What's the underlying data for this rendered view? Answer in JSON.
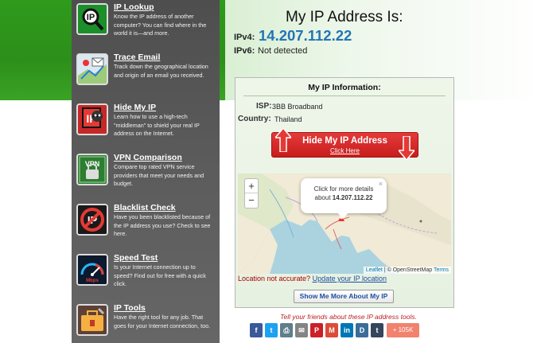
{
  "sidebar": {
    "items": [
      {
        "title": "IP Lookup",
        "desc": "Know the IP address of another computer? You can find where in the world it is—and more.",
        "icon": "ip-lookup-icon"
      },
      {
        "title": "Trace Email",
        "desc": "Track down the geographical location and origin of an email you received.",
        "icon": "trace-email-icon"
      },
      {
        "title": "Hide My IP",
        "desc": "Learn how to use a high-tech \"middleman\" to shield your real IP address on the Internet.",
        "icon": "hide-ip-icon"
      },
      {
        "title": "VPN Comparison",
        "desc": "Compare top rated VPN service providers that meet your needs and budget.",
        "icon": "vpn-icon"
      },
      {
        "title": "Blacklist Check",
        "desc": "Have you been blacklisted because of the IP address you use? Check to see here.",
        "icon": "blacklist-icon"
      },
      {
        "title": "Speed Test",
        "desc": "Is your Internet connection up to speed? Find out for free with a quick click.",
        "icon": "speed-test-icon"
      },
      {
        "title": "IP Tools",
        "desc": "Have the right tool for any job. That goes for your Internet connection, too.",
        "icon": "ip-tools-icon"
      }
    ],
    "icon_texts": {
      "vpn": "VPN",
      "speed": "Mbps",
      "ip": "IP"
    }
  },
  "header": {
    "title": "My IP Address Is:",
    "ipv4_label": "IPv4:",
    "ipv4_value": "14.207.112.22",
    "ipv6_label": "IPv6:",
    "ipv6_value": "Not detected"
  },
  "info": {
    "title": "My IP Information:",
    "isp_label": "ISP:",
    "isp_value": "3BB Broadband",
    "country_label": "Country:",
    "country_value": "Thailand",
    "hide_button_title": "Hide My IP Address",
    "hide_button_sub": "Click Here"
  },
  "map": {
    "zoom_in": "+",
    "zoom_out": "−",
    "popup_line1": "Click for more details",
    "popup_prefix": "about ",
    "popup_ip": "14.207.112.22",
    "popup_close": "×",
    "attr_leaflet": "Leaflet",
    "attr_sep": " | © OpenStreetMap ",
    "attr_terms": "Terms"
  },
  "accuracy": {
    "text": "Location not accurate? ",
    "link": "Update your IP location"
  },
  "more_button": "Show Me More About My IP",
  "share": {
    "text": "Tell your friends about these IP address tools.",
    "buttons": [
      {
        "glyph": "f",
        "color": "#3b5998",
        "icon": "facebook-icon"
      },
      {
        "glyph": "t",
        "color": "#1da1f2",
        "icon": "twitter-icon"
      },
      {
        "glyph": "⎙",
        "color": "#607d8b",
        "icon": "print-icon"
      },
      {
        "glyph": "✉",
        "color": "#848484",
        "icon": "email-icon"
      },
      {
        "glyph": "P",
        "color": "#cb2027",
        "icon": "pinterest-icon"
      },
      {
        "glyph": "M",
        "color": "#dd4b39",
        "icon": "gmail-icon"
      },
      {
        "glyph": "in",
        "color": "#0077b5",
        "icon": "linkedin-icon"
      },
      {
        "glyph": "D",
        "color": "#3a6d99",
        "icon": "digg-icon"
      },
      {
        "glyph": "t",
        "color": "#35465c",
        "icon": "tumblr-icon"
      }
    ],
    "plus_label": "+ 105K"
  },
  "colors": {
    "accent_blue": "#2375b5",
    "brand_green": "#2f9a1c",
    "button_red": "#d42a2a"
  }
}
